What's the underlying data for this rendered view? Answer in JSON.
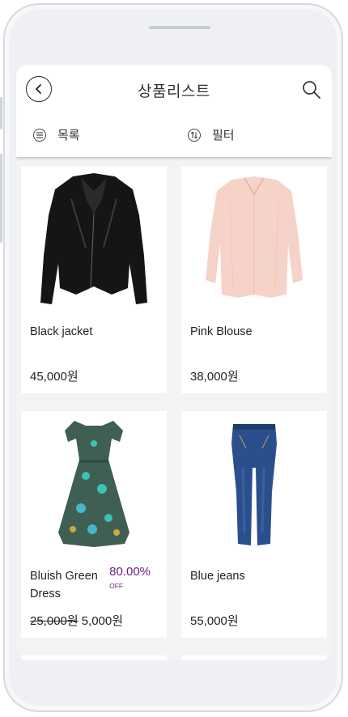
{
  "header": {
    "title": "상품리스트",
    "toolbar": {
      "list_label": "목록",
      "filter_label": "필터"
    }
  },
  "products": [
    {
      "name": "Black jacket",
      "price": "45,000원",
      "image": "black-leather-jacket"
    },
    {
      "name": "Pink Blouse",
      "price": "38,000원",
      "image": "pink-blouse"
    },
    {
      "name": "Bluish Green Dress",
      "old_price": "25,000원",
      "price": "5,000원",
      "discount_pct": "80.00%",
      "discount_label": "OFF",
      "image": "floral-dress"
    },
    {
      "name": "Blue jeans",
      "price": "55,000원",
      "image": "blue-jeans"
    }
  ],
  "colors": {
    "accent": "#6b1f86",
    "background": "#f3f3f4",
    "card": "#ffffff"
  }
}
